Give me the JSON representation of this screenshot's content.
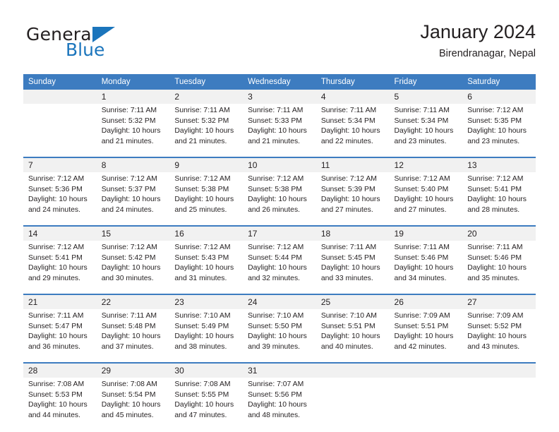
{
  "brand": {
    "name_part1": "General",
    "name_part2": "Blue",
    "triangle_icon": "blue-triangle-icon",
    "accent_color": "#1b75bc"
  },
  "header": {
    "title": "January 2024",
    "subtitle": "Birendranagar, Nepal"
  },
  "theme": {
    "header_bg": "#3d7cc0",
    "daynum_bg": "#f1f1f1",
    "rule_color": "#3d7cc0",
    "text_color": "#231f20"
  },
  "calendar": {
    "weekday_headers": [
      "Sunday",
      "Monday",
      "Tuesday",
      "Wednesday",
      "Thursday",
      "Friday",
      "Saturday"
    ],
    "weeks": [
      {
        "days": [
          {
            "num": "",
            "l1": "",
            "l2": "",
            "l3": "",
            "l4": ""
          },
          {
            "num": "1",
            "l1": "Sunrise: 7:11 AM",
            "l2": "Sunset: 5:32 PM",
            "l3": "Daylight: 10 hours",
            "l4": "and 21 minutes."
          },
          {
            "num": "2",
            "l1": "Sunrise: 7:11 AM",
            "l2": "Sunset: 5:32 PM",
            "l3": "Daylight: 10 hours",
            "l4": "and 21 minutes."
          },
          {
            "num": "3",
            "l1": "Sunrise: 7:11 AM",
            "l2": "Sunset: 5:33 PM",
            "l3": "Daylight: 10 hours",
            "l4": "and 21 minutes."
          },
          {
            "num": "4",
            "l1": "Sunrise: 7:11 AM",
            "l2": "Sunset: 5:34 PM",
            "l3": "Daylight: 10 hours",
            "l4": "and 22 minutes."
          },
          {
            "num": "5",
            "l1": "Sunrise: 7:11 AM",
            "l2": "Sunset: 5:34 PM",
            "l3": "Daylight: 10 hours",
            "l4": "and 23 minutes."
          },
          {
            "num": "6",
            "l1": "Sunrise: 7:12 AM",
            "l2": "Sunset: 5:35 PM",
            "l3": "Daylight: 10 hours",
            "l4": "and 23 minutes."
          }
        ]
      },
      {
        "days": [
          {
            "num": "7",
            "l1": "Sunrise: 7:12 AM",
            "l2": "Sunset: 5:36 PM",
            "l3": "Daylight: 10 hours",
            "l4": "and 24 minutes."
          },
          {
            "num": "8",
            "l1": "Sunrise: 7:12 AM",
            "l2": "Sunset: 5:37 PM",
            "l3": "Daylight: 10 hours",
            "l4": "and 24 minutes."
          },
          {
            "num": "9",
            "l1": "Sunrise: 7:12 AM",
            "l2": "Sunset: 5:38 PM",
            "l3": "Daylight: 10 hours",
            "l4": "and 25 minutes."
          },
          {
            "num": "10",
            "l1": "Sunrise: 7:12 AM",
            "l2": "Sunset: 5:38 PM",
            "l3": "Daylight: 10 hours",
            "l4": "and 26 minutes."
          },
          {
            "num": "11",
            "l1": "Sunrise: 7:12 AM",
            "l2": "Sunset: 5:39 PM",
            "l3": "Daylight: 10 hours",
            "l4": "and 27 minutes."
          },
          {
            "num": "12",
            "l1": "Sunrise: 7:12 AM",
            "l2": "Sunset: 5:40 PM",
            "l3": "Daylight: 10 hours",
            "l4": "and 27 minutes."
          },
          {
            "num": "13",
            "l1": "Sunrise: 7:12 AM",
            "l2": "Sunset: 5:41 PM",
            "l3": "Daylight: 10 hours",
            "l4": "and 28 minutes."
          }
        ]
      },
      {
        "days": [
          {
            "num": "14",
            "l1": "Sunrise: 7:12 AM",
            "l2": "Sunset: 5:41 PM",
            "l3": "Daylight: 10 hours",
            "l4": "and 29 minutes."
          },
          {
            "num": "15",
            "l1": "Sunrise: 7:12 AM",
            "l2": "Sunset: 5:42 PM",
            "l3": "Daylight: 10 hours",
            "l4": "and 30 minutes."
          },
          {
            "num": "16",
            "l1": "Sunrise: 7:12 AM",
            "l2": "Sunset: 5:43 PM",
            "l3": "Daylight: 10 hours",
            "l4": "and 31 minutes."
          },
          {
            "num": "17",
            "l1": "Sunrise: 7:12 AM",
            "l2": "Sunset: 5:44 PM",
            "l3": "Daylight: 10 hours",
            "l4": "and 32 minutes."
          },
          {
            "num": "18",
            "l1": "Sunrise: 7:11 AM",
            "l2": "Sunset: 5:45 PM",
            "l3": "Daylight: 10 hours",
            "l4": "and 33 minutes."
          },
          {
            "num": "19",
            "l1": "Sunrise: 7:11 AM",
            "l2": "Sunset: 5:46 PM",
            "l3": "Daylight: 10 hours",
            "l4": "and 34 minutes."
          },
          {
            "num": "20",
            "l1": "Sunrise: 7:11 AM",
            "l2": "Sunset: 5:46 PM",
            "l3": "Daylight: 10 hours",
            "l4": "and 35 minutes."
          }
        ]
      },
      {
        "days": [
          {
            "num": "21",
            "l1": "Sunrise: 7:11 AM",
            "l2": "Sunset: 5:47 PM",
            "l3": "Daylight: 10 hours",
            "l4": "and 36 minutes."
          },
          {
            "num": "22",
            "l1": "Sunrise: 7:11 AM",
            "l2": "Sunset: 5:48 PM",
            "l3": "Daylight: 10 hours",
            "l4": "and 37 minutes."
          },
          {
            "num": "23",
            "l1": "Sunrise: 7:10 AM",
            "l2": "Sunset: 5:49 PM",
            "l3": "Daylight: 10 hours",
            "l4": "and 38 minutes."
          },
          {
            "num": "24",
            "l1": "Sunrise: 7:10 AM",
            "l2": "Sunset: 5:50 PM",
            "l3": "Daylight: 10 hours",
            "l4": "and 39 minutes."
          },
          {
            "num": "25",
            "l1": "Sunrise: 7:10 AM",
            "l2": "Sunset: 5:51 PM",
            "l3": "Daylight: 10 hours",
            "l4": "and 40 minutes."
          },
          {
            "num": "26",
            "l1": "Sunrise: 7:09 AM",
            "l2": "Sunset: 5:51 PM",
            "l3": "Daylight: 10 hours",
            "l4": "and 42 minutes."
          },
          {
            "num": "27",
            "l1": "Sunrise: 7:09 AM",
            "l2": "Sunset: 5:52 PM",
            "l3": "Daylight: 10 hours",
            "l4": "and 43 minutes."
          }
        ]
      },
      {
        "days": [
          {
            "num": "28",
            "l1": "Sunrise: 7:08 AM",
            "l2": "Sunset: 5:53 PM",
            "l3": "Daylight: 10 hours",
            "l4": "and 44 minutes."
          },
          {
            "num": "29",
            "l1": "Sunrise: 7:08 AM",
            "l2": "Sunset: 5:54 PM",
            "l3": "Daylight: 10 hours",
            "l4": "and 45 minutes."
          },
          {
            "num": "30",
            "l1": "Sunrise: 7:08 AM",
            "l2": "Sunset: 5:55 PM",
            "l3": "Daylight: 10 hours",
            "l4": "and 47 minutes."
          },
          {
            "num": "31",
            "l1": "Sunrise: 7:07 AM",
            "l2": "Sunset: 5:56 PM",
            "l3": "Daylight: 10 hours",
            "l4": "and 48 minutes."
          },
          {
            "num": "",
            "l1": "",
            "l2": "",
            "l3": "",
            "l4": ""
          },
          {
            "num": "",
            "l1": "",
            "l2": "",
            "l3": "",
            "l4": ""
          },
          {
            "num": "",
            "l1": "",
            "l2": "",
            "l3": "",
            "l4": ""
          }
        ]
      }
    ]
  }
}
